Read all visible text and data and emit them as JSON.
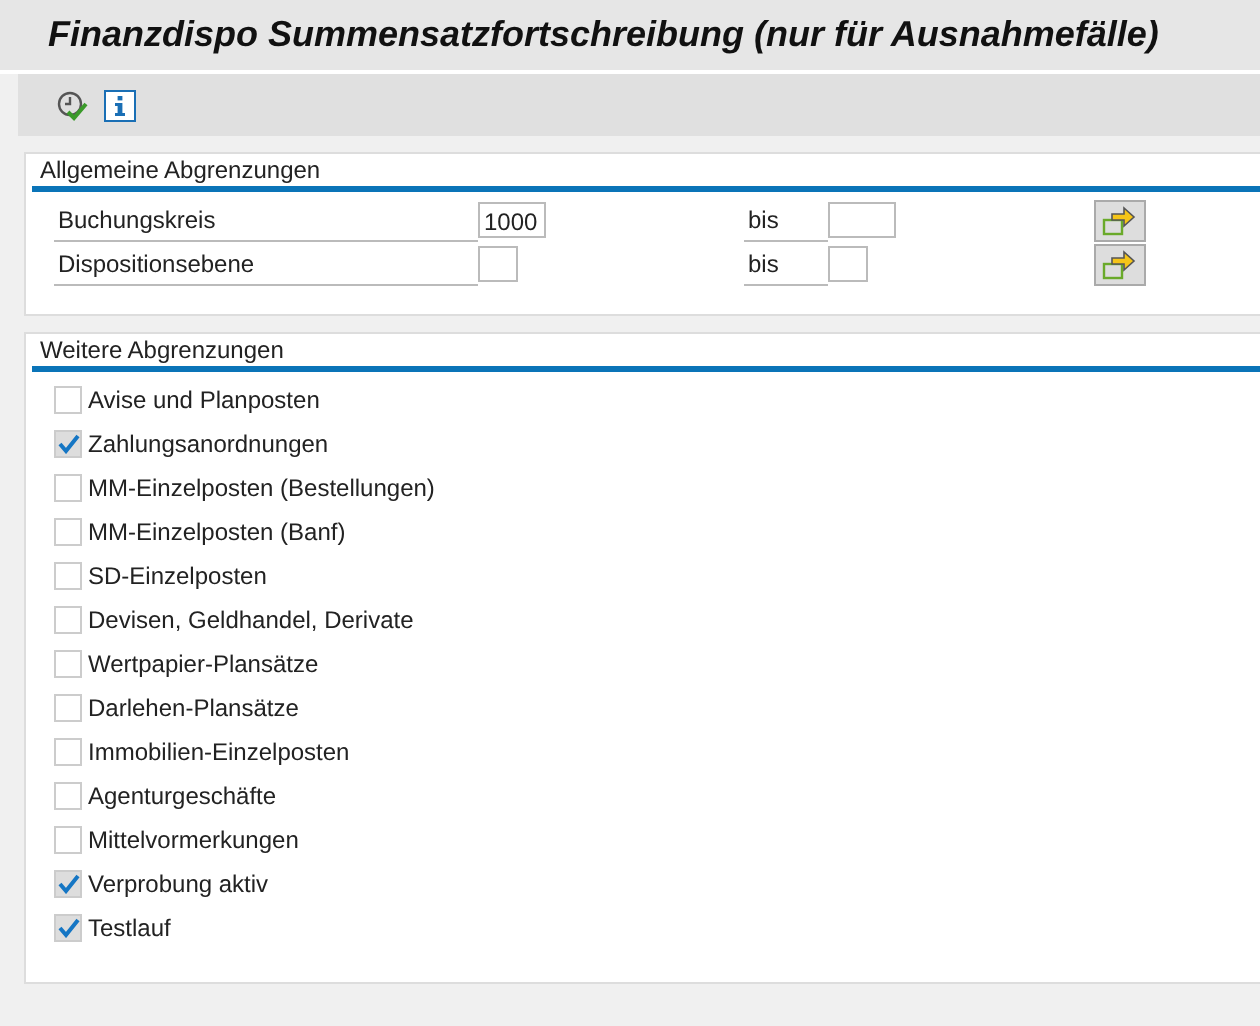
{
  "window": {
    "title": "Finanzdispo Summensatzfortschreibung (nur für Ausnahmefälle)"
  },
  "toolbar": {
    "buttons": [
      {
        "kind": "execute"
      },
      {
        "kind": "info"
      }
    ]
  },
  "general_section": {
    "title": "Allgemeine Abgrenzungen",
    "rows": [
      {
        "label": "Buchungskreis",
        "value": "1000",
        "to_label": "bis",
        "kind": "wide"
      },
      {
        "label": "Dispositionsebene",
        "to_label": "bis",
        "kind": "narrow"
      }
    ]
  },
  "further_section": {
    "title": "Weitere Abgrenzungen",
    "options": [
      {
        "label": "Avise und Planposten",
        "checked": false
      },
      {
        "label": "Zahlungsanordnungen",
        "checked": true
      },
      {
        "label": "MM-Einzelposten (Bestellungen)",
        "checked": false
      },
      {
        "label": "MM-Einzelposten (Banf)",
        "checked": false
      },
      {
        "label": "SD-Einzelposten",
        "checked": false
      },
      {
        "label": "Devisen, Geldhandel, Derivate",
        "checked": false
      },
      {
        "label": "Wertpapier-Plansätze",
        "checked": false
      },
      {
        "label": "Darlehen-Plansätze",
        "checked": false
      },
      {
        "label": "Immobilien-Einzelposten",
        "checked": false
      },
      {
        "label": "Agenturgeschäfte",
        "checked": false
      },
      {
        "label": "Mittelvormerkungen",
        "checked": false
      },
      {
        "label": "Verprobung aktiv",
        "checked": true
      },
      {
        "label": "Testlauf",
        "checked": true
      }
    ]
  }
}
